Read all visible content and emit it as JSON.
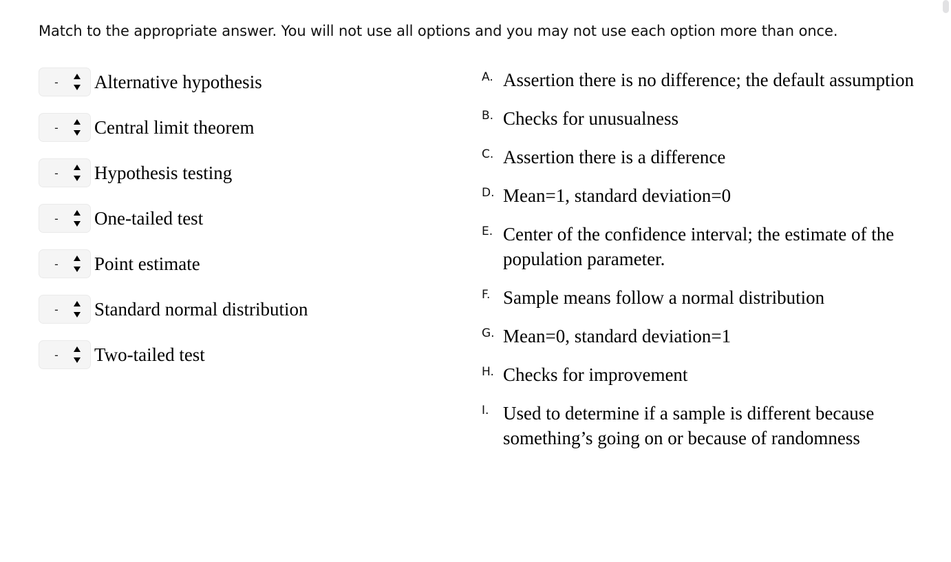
{
  "prompt": {
    "text": "Match to the appropriate answer. You will not use all options and you may not use each option more than once."
  },
  "select": {
    "placeholder_value": "-",
    "spinner_icon": "updown-spinner-icon"
  },
  "match_items": [
    {
      "label": "Alternative hypothesis",
      "selected": "-"
    },
    {
      "label": "Central limit theorem",
      "selected": "-"
    },
    {
      "label": "Hypothesis testing",
      "selected": "-"
    },
    {
      "label": "One-tailed test",
      "selected": "-"
    },
    {
      "label": "Point estimate",
      "selected": "-"
    },
    {
      "label": "Standard normal distribution",
      "selected": "-"
    },
    {
      "label": "Two-tailed test",
      "selected": "-"
    }
  ],
  "answer_options": [
    {
      "letter": "A.",
      "text": "Assertion there is no difference; the default assumption"
    },
    {
      "letter": "B.",
      "text": "Checks for unusualness"
    },
    {
      "letter": "C.",
      "text": "Assertion there is a difference"
    },
    {
      "letter": "D.",
      "text": "Mean=1, standard deviation=0"
    },
    {
      "letter": "E.",
      "text": "Center of the confidence interval; the estimate of the population parameter."
    },
    {
      "letter": "F.",
      "text": "Sample means follow a normal distribution"
    },
    {
      "letter": "G.",
      "text": "Mean=0, standard deviation=1"
    },
    {
      "letter": "H.",
      "text": "Checks for improvement"
    },
    {
      "letter": "I.",
      "text": "Used to determine if a sample is different because something’s going on or because of randomness"
    }
  ],
  "colors": {
    "background": "#ffffff",
    "text": "#000000",
    "select_background": "#f5f5f5",
    "select_border": "#eaeaea",
    "scrollbar_thumb": "#e2e2e4"
  }
}
